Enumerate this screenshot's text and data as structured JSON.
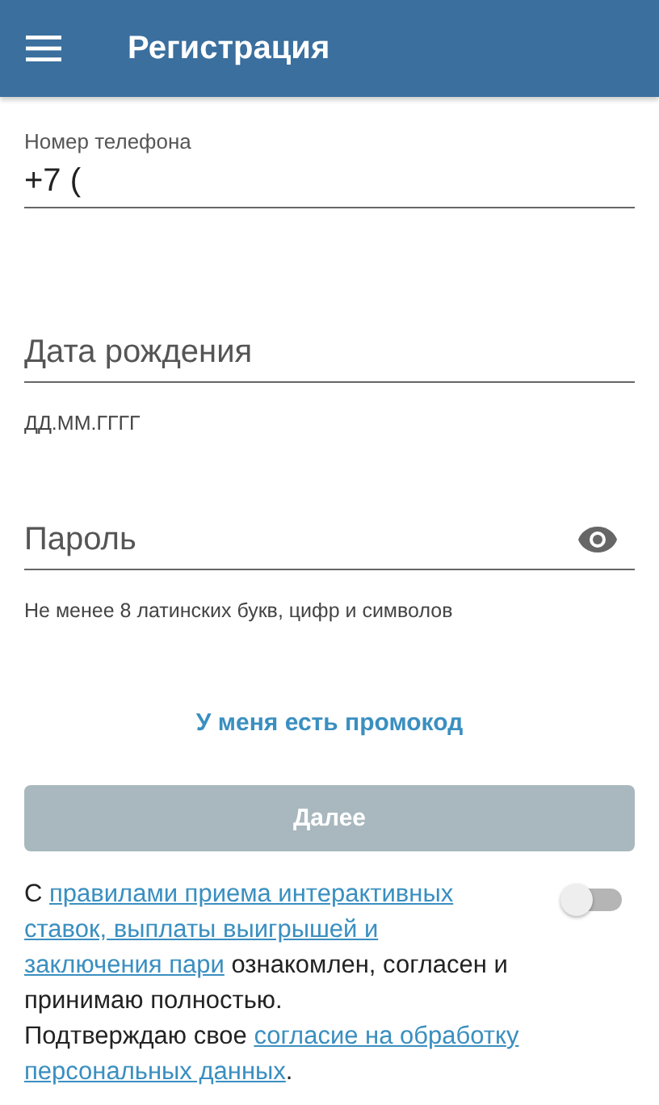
{
  "app_bar": {
    "title": "Регистрация"
  },
  "fields": [
    {
      "kind": "labeled",
      "label": "Номер телефона",
      "value": "+7 ("
    },
    {
      "kind": "plain",
      "placeholder": "Дата рождения",
      "hint": "ДД.ММ.ГГГГ"
    },
    {
      "kind": "password",
      "placeholder": "Пароль",
      "hint": "Не менее 8 латинских букв, цифр и символов"
    }
  ],
  "promo_link": "У меня есть промокод",
  "next_button": {
    "label": "Далее",
    "disabled": true
  },
  "consent": {
    "on": false,
    "paragraphs": [
      [
        {
          "kind": "text",
          "text": "С "
        },
        {
          "kind": "link",
          "text": "правилами приема интерактивных"
        },
        {
          "kind": "link",
          "text": "ставок, выплаты выигрышей и"
        },
        {
          "kind": "link",
          "text": "заключения пари"
        },
        {
          "kind": "text",
          "text": " ознакомлен, согласен и принимаю полностью."
        }
      ],
      [
        {
          "kind": "text",
          "text": "Подтверждаю свое "
        },
        {
          "kind": "link",
          "text": "согласие на обработку"
        },
        {
          "kind": "link",
          "text": "персональных данных"
        },
        {
          "kind": "text",
          "text": "."
        }
      ]
    ]
  }
}
